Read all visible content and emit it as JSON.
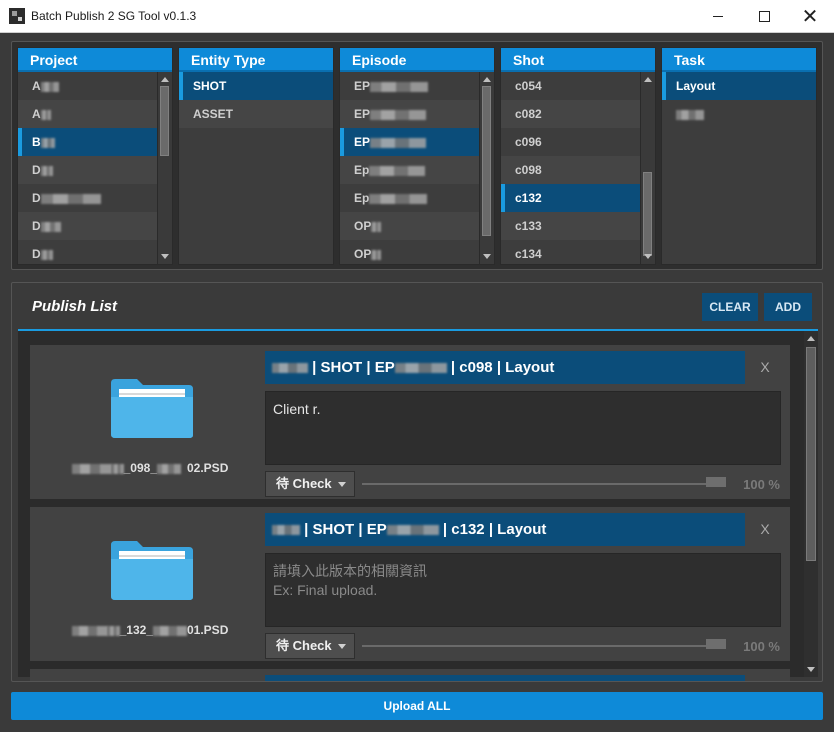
{
  "window": {
    "title": "Batch Publish 2 SG Tool v0.1.3",
    "close_glyph": "✕"
  },
  "columns": [
    {
      "header": "Project",
      "items": [
        "A",
        "A",
        "B",
        "D",
        "D",
        "D",
        "D"
      ],
      "selected": 2
    },
    {
      "header": "Entity Type",
      "items": [
        "SHOT",
        "ASSET"
      ],
      "selected": 0
    },
    {
      "header": "Episode",
      "items": [
        "EP",
        "EP",
        "EP",
        "Ep",
        "Ep",
        "OP",
        "OP"
      ],
      "selected": 2
    },
    {
      "header": "Shot",
      "items": [
        "c054",
        "c082",
        "c096",
        "c098",
        "c132",
        "c133",
        "c134"
      ],
      "selected": 4
    },
    {
      "header": "Task",
      "items": [
        "Layout",
        ""
      ],
      "selected": 0
    }
  ],
  "publish": {
    "title": "Publish List",
    "clear_label": "CLEAR",
    "add_label": "ADD",
    "items": [
      {
        "filename_prefix": "",
        "filename_mid": "_098_",
        "filename_end": "02.PSD",
        "tag_sep": " | SHOT | EP",
        "tag_tail": " | c098 | Layout",
        "remove_label": "X",
        "notes": "Client r.",
        "status": "待 Check",
        "progress_label": "100 %",
        "progress": 1.0
      },
      {
        "filename_prefix": "",
        "filename_mid": "_132_",
        "filename_end": "01.PSD",
        "tag_sep": " | SHOT | EP",
        "tag_tail": " | c132 | Layout",
        "remove_label": "X",
        "notes_placeholder_line1": "請填入此版本的相關資訊",
        "notes_placeholder_line2": "Ex: Final upload.",
        "status": "待 Check",
        "progress_label": "100 %",
        "progress": 1.0
      }
    ]
  },
  "upload_all_label": "Upload ALL",
  "colors": {
    "accent": "#0e8ad8",
    "selected": "#0b4d7a",
    "background": "#3a3a3a"
  }
}
